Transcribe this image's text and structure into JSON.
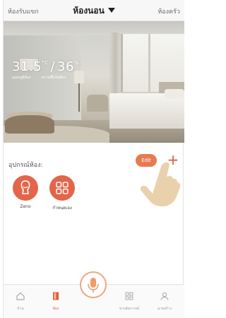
{
  "header": {
    "left_link": "ห้องรับแขก",
    "title": "ห้องนอน",
    "right_link": "ห้องครัว"
  },
  "room_status": {
    "temperature": "31.5",
    "temperature_unit": "°C",
    "humidity": "36",
    "humidity_unit": "%",
    "temperature_label": "อุณหภูมิห้อง",
    "humidity_label": "ความชื้นในห้อง"
  },
  "devices_section": {
    "title": "อุปกรณ์ห้อง:",
    "edit_label": "Edit",
    "add_label": "+",
    "devices": [
      {
        "label": "Zeno",
        "icon": "person-silhouette-icon"
      },
      {
        "label": "กำหนดเอง",
        "icon": "grid-squares-icon"
      }
    ]
  },
  "tabbar": {
    "tabs": [
      {
        "label": "บ้าน",
        "icon": "home-icon",
        "active": false
      },
      {
        "label": "ห้อง",
        "icon": "door-icon",
        "active": true
      },
      {
        "label": "",
        "icon": "microphone-icon",
        "active": false
      },
      {
        "label": "ทางลัดการณ์",
        "icon": "grid-icon",
        "active": false
      },
      {
        "label": "ฉายสร้าง",
        "icon": "user-icon",
        "active": false
      }
    ]
  },
  "colors": {
    "accent": "#e3654a",
    "accent_dark": "#e0582e",
    "edit_button": "#e87a52"
  }
}
